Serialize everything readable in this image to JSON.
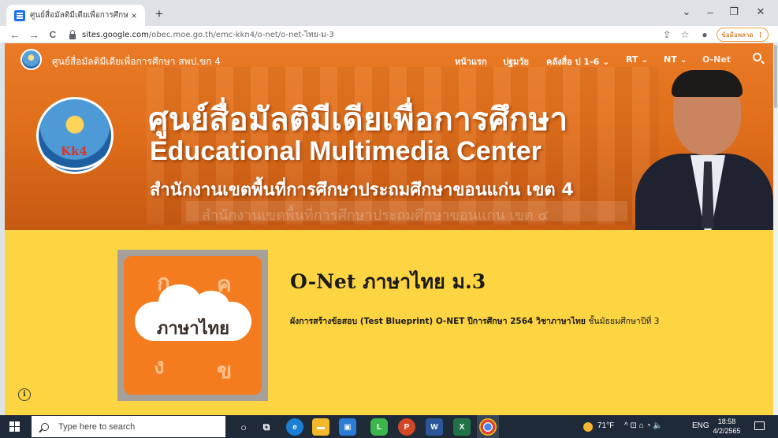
{
  "browser": {
    "tab_title": "ศูนย์สื่อมัลติมีเดียเพื่อการศึกษา สพป.ข",
    "tab_close": "×",
    "new_tab": "+",
    "url_host": "sites.google.com",
    "url_path": "/obec.moe.go.th/emc-kkn4/o-net/o-net-ไทย-ม-3",
    "update_label": "ข้อมือพลาด",
    "window_controls": [
      "⌄",
      "–",
      "❐",
      "✕"
    ],
    "nav": {
      "back": "←",
      "forward": "→",
      "reload": "C"
    }
  },
  "site": {
    "name": "ศูนย์สื่อมัลติมีเดียเพื่อการศึกษา สพป.ขก 4",
    "menu": [
      "หน้าแรก",
      "ปฐมวัย",
      "คลังสื่อ ป 1-6 ⌄",
      "RT ⌄",
      "NT ⌄",
      "O-Net"
    ]
  },
  "hero": {
    "title_thai": "ศูนย์สื่อมัลติมีเดียเพื่อการศึกษา",
    "title_eng": "Educational Multimedia Center",
    "subtitle": "สำนักงานเขตพื้นที่การศึกษาประถมศึกษาขอนแก่น เขต 4",
    "background_text": "สำนักงานเขตพื้นที่การศึกษาประถมศึกษาขอนแก่น เขต ๔",
    "emblem_text": "Kk4",
    "emblem_small": "4"
  },
  "post": {
    "title": "O-Net ภาษาไทย ม.3",
    "description_bold": "ผังการสร้างข้อสอบ (Test Blueprint) O-NET ปีการศึกษา 2564 วิชาภาษาไทย",
    "description_rest": " ชั้นมัธยมศึกษาปีที่ 3",
    "thumbnail": {
      "label": "ภาษาไทย",
      "letters": [
        "ก",
        "ค",
        "ง",
        "ข"
      ]
    }
  },
  "taskbar": {
    "search_placeholder": "Type here to search",
    "weather": "71°F",
    "language": "ENG",
    "time": "18:58",
    "date": "4/2/2565",
    "tray_icons": "^  ⊡  ⌂  ◔  🔈"
  },
  "colors": {
    "page_background": "#fdd441",
    "hero_orange": "#e06f1b",
    "thumbnail_orange": "#f47c1e",
    "taskbar": "#1f2a38"
  },
  "icons": [
    "search-icon",
    "lock-icon",
    "info-icon",
    "windows-start-icon",
    "share-icon",
    "star-icon",
    "profile-icon"
  ]
}
